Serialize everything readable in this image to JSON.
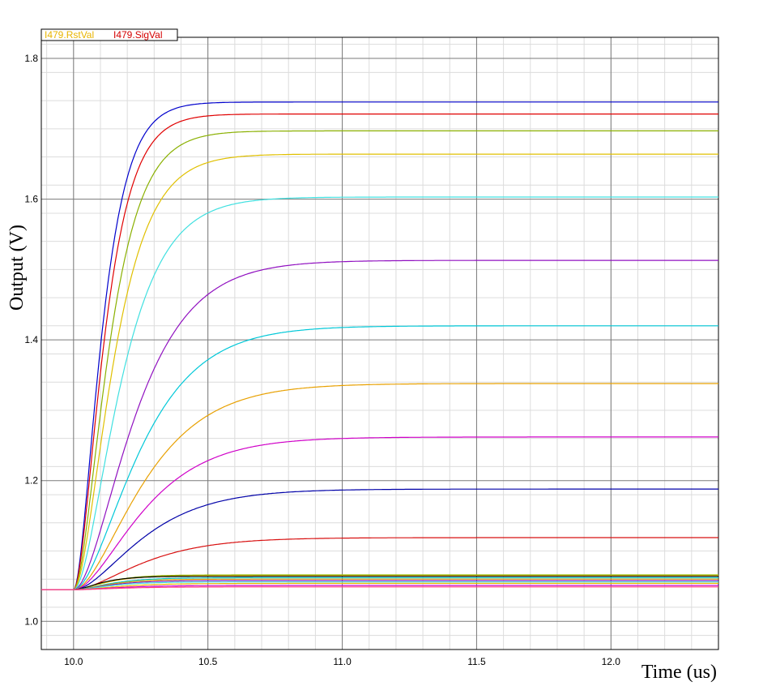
{
  "chart_data": {
    "type": "line",
    "xlabel": "Time (us)",
    "ylabel": "Output (V)",
    "xlim": [
      9.88,
      12.4
    ],
    "ylim": [
      0.96,
      1.83
    ],
    "xticks": [
      "10.0",
      "10.5",
      "11.0",
      "11.5",
      "12.0"
    ],
    "yticks": [
      "1.0",
      "1.2",
      "1.4",
      "1.6",
      "1.8"
    ],
    "xtick_values": [
      10.0,
      10.5,
      11.0,
      11.5,
      12.0
    ],
    "ytick_values": [
      1.0,
      1.2,
      1.4,
      1.6,
      1.8
    ],
    "grid": "major and minor",
    "legend": {
      "position": "top-left",
      "entries": [
        {
          "label": "I479.RstVal",
          "color": "#e8b400"
        },
        {
          "label": "I479.SigVal",
          "color": "#d40000"
        }
      ]
    },
    "step_start": 10.0,
    "baseline": 1.045,
    "series": [
      {
        "color": "#0000cc",
        "final": 1.738,
        "tau": 0.06
      },
      {
        "color": "#e00000",
        "final": 1.721,
        "tau": 0.065
      },
      {
        "color": "#8ab000",
        "final": 1.697,
        "tau": 0.075
      },
      {
        "color": "#e0c000",
        "final": 1.664,
        "tau": 0.085
      },
      {
        "color": "#40e0e0",
        "final": 1.603,
        "tau": 0.1
      },
      {
        "color": "#9010c0",
        "final": 1.513,
        "tau": 0.13
      },
      {
        "color": "#00c8d8",
        "final": 1.42,
        "tau": 0.14
      },
      {
        "color": "#e8a000",
        "final": 1.338,
        "tau": 0.15
      },
      {
        "color": "#d000c8",
        "final": 1.262,
        "tau": 0.15
      },
      {
        "color": "#0000a8",
        "final": 1.188,
        "tau": 0.15
      },
      {
        "color": "#d81010",
        "final": 1.119,
        "tau": 0.15
      },
      {
        "color": "#8ab000",
        "final": 1.066,
        "tau": 0.07
      },
      {
        "color": "#e0c000",
        "final": 1.065,
        "tau": 0.07
      },
      {
        "color": "#000000",
        "final": 1.064,
        "tau": 0.06
      },
      {
        "color": "#00c0c0",
        "final": 1.062,
        "tau": 0.08
      },
      {
        "color": "#e8a000",
        "final": 1.06,
        "tau": 0.08
      },
      {
        "color": "#8020c0",
        "final": 1.058,
        "tau": 0.08
      },
      {
        "color": "#40e0e0",
        "final": 1.056,
        "tau": 0.08
      },
      {
        "color": "#e8b400",
        "final": 1.054,
        "tau": 0.1
      },
      {
        "color": "#d000c8",
        "final": 1.051,
        "tau": 0.1
      },
      {
        "color": "#ff4080",
        "final": 1.049,
        "tau": 0.1
      }
    ]
  }
}
